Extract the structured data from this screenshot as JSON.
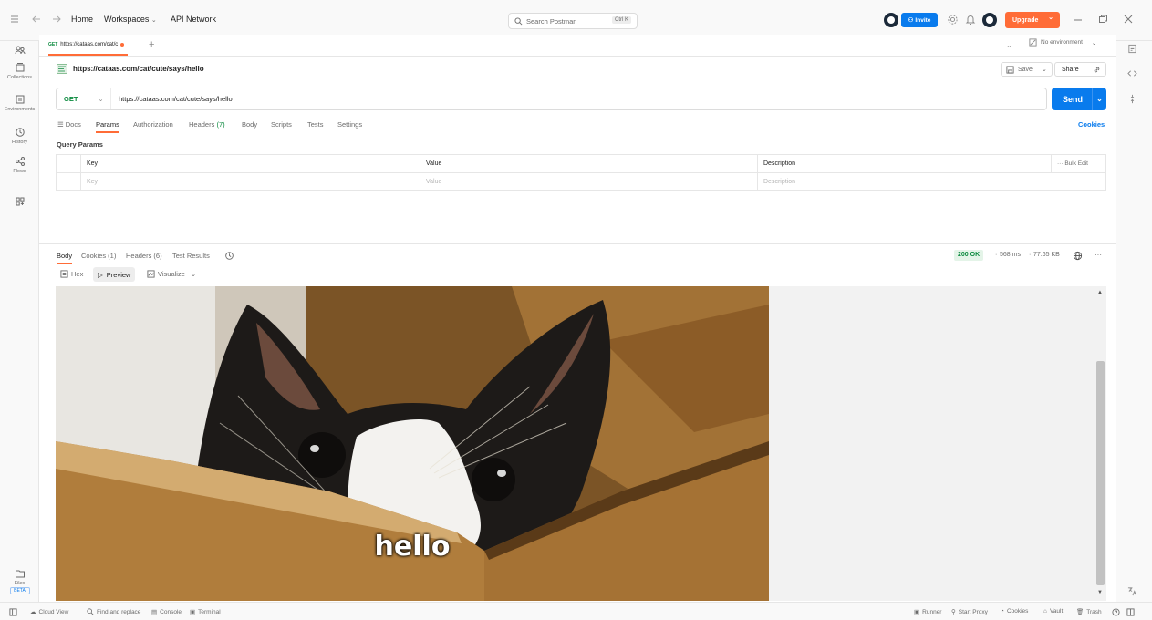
{
  "topbar": {
    "nav_home": "Home",
    "nav_workspaces": "Workspaces",
    "nav_api_network": "API Network",
    "search_placeholder": "Search Postman",
    "search_shortcut": "Ctrl K",
    "invite_label": "Invite",
    "upgrade_label": "Upgrade",
    "colors": {
      "invite": "#097bed",
      "upgrade": "#ff6c37"
    }
  },
  "sidebar": {
    "items": [
      {
        "label": "",
        "icon": "team-icon"
      },
      {
        "label": "Collections",
        "icon": "collections-icon"
      },
      {
        "label": "Environments",
        "icon": "environments-icon"
      },
      {
        "label": "History",
        "icon": "history-icon"
      },
      {
        "label": "Flows",
        "icon": "flows-icon"
      },
      {
        "label": "",
        "icon": "add-workbench-icon"
      }
    ],
    "files_label": "Files",
    "files_badge": "BETA"
  },
  "tabs": {
    "active_method": "GET",
    "active_title": "https://cataas.com/cat/c",
    "environment": "No environment"
  },
  "request": {
    "title": "https://cataas.com/cat/cute/says/hello",
    "save_label": "Save",
    "share_label": "Share",
    "method": "GET",
    "url": "https://cataas.com/cat/cute/says/hello",
    "send_label": "Send",
    "tabs": {
      "docs": "Docs",
      "params": "Params",
      "authorization": "Authorization",
      "headers": "Headers",
      "headers_count": "(7)",
      "body": "Body",
      "scripts": "Scripts",
      "tests": "Tests",
      "settings": "Settings"
    },
    "cookies_label": "Cookies",
    "query_params_title": "Query Params",
    "table": {
      "col_key": "Key",
      "col_value": "Value",
      "col_description": "Description",
      "bulk_edit": "Bulk Edit",
      "placeholder_key": "Key",
      "placeholder_value": "Value",
      "placeholder_description": "Description"
    }
  },
  "response": {
    "tabs": {
      "body": "Body",
      "cookies": "Cookies (1)",
      "headers": "Headers (6)",
      "test_results": "Test Results"
    },
    "status": "200 OK",
    "time": "568 ms",
    "size": "77.65 KB",
    "view_modes": {
      "hex": "Hex",
      "preview": "Preview",
      "visualize": "Visualize"
    },
    "image_caption": "hello",
    "status_color": "#0b8a3e"
  },
  "statusbar": {
    "cloud_view": "Cloud View",
    "find_replace": "Find and replace",
    "console": "Console",
    "terminal": "Terminal",
    "runner": "Runner",
    "start_proxy": "Start Proxy",
    "cookies": "Cookies",
    "vault": "Vault",
    "trash": "Trash"
  }
}
